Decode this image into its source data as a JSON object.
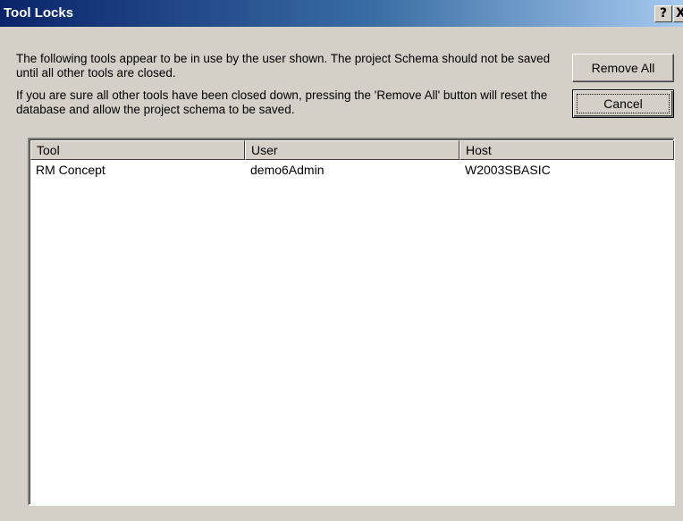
{
  "window": {
    "title": "Tool Locks",
    "help_label": "?",
    "close_label": "X"
  },
  "message": {
    "line1": "The following tools appear to be in use by the user shown. The project Schema should not be saved until all other tools are closed.",
    "line2": "If you are sure all other tools have been closed down, pressing the 'Remove All' button will reset the database and allow the project schema to be saved."
  },
  "buttons": {
    "remove_all": "Remove All",
    "cancel": "Cancel"
  },
  "table": {
    "columns": [
      "Tool",
      "User",
      "Host"
    ],
    "rows": [
      {
        "tool": "RM Concept",
        "user": "demo6Admin",
        "host": "W2003SBASIC"
      }
    ]
  }
}
